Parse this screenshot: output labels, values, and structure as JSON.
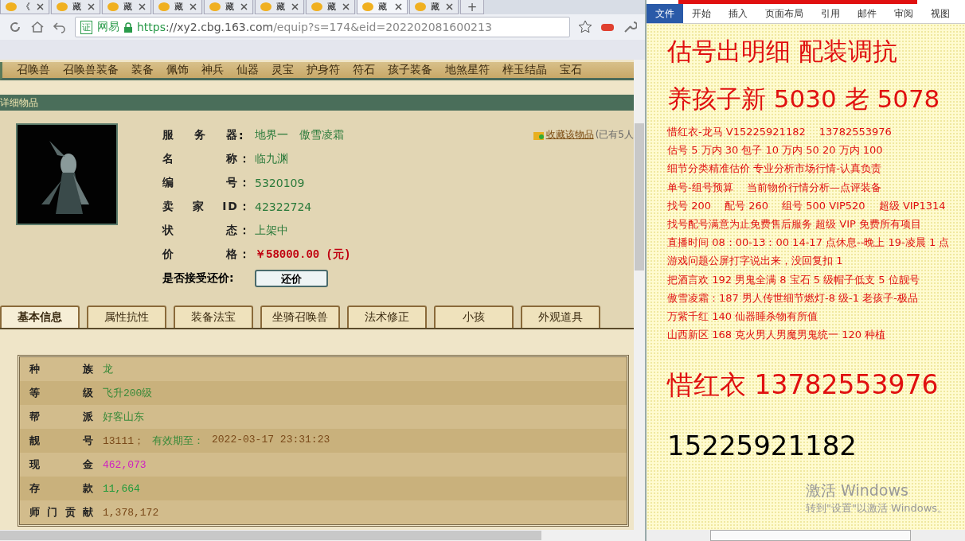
{
  "browser": {
    "tabs": [
      {
        "label": "《",
        "selected": false
      },
      {
        "label": "藏",
        "selected": false
      },
      {
        "label": "藏",
        "selected": false
      },
      {
        "label": "藏",
        "selected": false
      },
      {
        "label": "藏",
        "selected": false
      },
      {
        "label": "藏",
        "selected": false
      },
      {
        "label": "藏",
        "selected": false
      },
      {
        "label": "藏",
        "selected": true
      },
      {
        "label": "藏",
        "selected": false
      }
    ],
    "new_tab": "+",
    "address": {
      "badge": "证",
      "site": "网易",
      "scheme": "https",
      "host": "://xy2.cbg.163.com",
      "path": "/equip?s=174&eid=202202081600213"
    }
  },
  "page": {
    "nav": [
      "召唤兽",
      "召唤兽装备",
      "装备",
      "佩饰",
      "神兵",
      "仙器",
      "灵宝",
      "护身符",
      "符石",
      "孩子装备",
      "地煞星符",
      "梓玉结晶",
      "宝石"
    ],
    "section_title": "详细物品",
    "details": [
      {
        "label": "服务器",
        "colon": ":",
        "value": "地界一　傲雪凌霜",
        "kind": "text"
      },
      {
        "label": "名称",
        "colon": "：",
        "value": "临九渊",
        "kind": "text"
      },
      {
        "label": "编号",
        "colon": "：",
        "value": "5320109",
        "kind": "text"
      },
      {
        "label": "卖家ID",
        "colon": "：",
        "value": "42322724",
        "kind": "text"
      },
      {
        "label": "状态",
        "colon": "：",
        "value": "上架中",
        "kind": "text"
      },
      {
        "label": "价格",
        "colon": "：",
        "value": "￥58000.00 (元)",
        "kind": "price"
      }
    ],
    "bargain": {
      "label": "是否接受还价:",
      "button": "还价"
    },
    "favorite": {
      "link": "收藏该物品",
      "note": "(已有5人"
    },
    "tabs": [
      {
        "label": "基本信息",
        "selected": true
      },
      {
        "label": "属性抗性",
        "selected": false
      },
      {
        "label": "装备法宝",
        "selected": false
      },
      {
        "label": "坐骑召唤兽",
        "selected": false
      },
      {
        "label": "法术修正",
        "selected": false
      },
      {
        "label": "小孩",
        "selected": false
      },
      {
        "label": "外观道具",
        "selected": false
      }
    ],
    "info_rows": [
      {
        "label": "种族",
        "segments": [
          {
            "text": "龙",
            "color": "#3a8a3a"
          }
        ]
      },
      {
        "label": "等级",
        "segments": [
          {
            "text": "飞升200级",
            "color": "#3a8a3a"
          }
        ]
      },
      {
        "label": "帮派",
        "segments": [
          {
            "text": "好客山东",
            "color": "#3a8a3a"
          }
        ]
      },
      {
        "label": "靓号",
        "segments": [
          {
            "text": "13111；",
            "color": "#7a4a1a"
          },
          {
            "text": "有效期至：",
            "color": "#3a8a3a"
          },
          {
            "text": "2022-03-17 23:31:23",
            "color": "#7a4a1a"
          }
        ]
      },
      {
        "label": "现金",
        "segments": [
          {
            "text": "462,073",
            "color": "#d020c0"
          }
        ]
      },
      {
        "label": "存款",
        "segments": [
          {
            "text": "11,664",
            "color": "#1f9a3a"
          }
        ]
      },
      {
        "label": "师门贡献",
        "segments": [
          {
            "text": "1,378,172",
            "color": "#7a4a1a"
          }
        ]
      }
    ]
  },
  "word": {
    "tabs": [
      {
        "label": "文件",
        "selected": true
      },
      {
        "label": "开始",
        "selected": false
      },
      {
        "label": "插入",
        "selected": false
      },
      {
        "label": "页面布局",
        "selected": false
      },
      {
        "label": "引用",
        "selected": false
      },
      {
        "label": "邮件",
        "selected": false
      },
      {
        "label": "审阅",
        "selected": false
      },
      {
        "label": "视图",
        "selected": false
      }
    ],
    "lines": [
      {
        "text": "估号出明细  配装调抗",
        "kind": "heading"
      },
      {
        "text": "养孩子新 5030 老 5078",
        "kind": "heading"
      },
      {
        "text": "惜红衣-龙马 V15225921182　 13782553976",
        "kind": "body"
      },
      {
        "text": "估号 5 万内 30 包子  10 万内 50  20 万内 100",
        "kind": "body"
      },
      {
        "text": "细节分类精准估价  专业分析市场行情-认真负责",
        "kind": "body"
      },
      {
        "text": "单号-组号预算　 当前物价行情分析—点评装备",
        "kind": "body"
      },
      {
        "text": "找号 200　 配号 260　 组号 500  VIP520　 超级 VIP1314",
        "kind": "body"
      },
      {
        "text": "找号配号满意为止免费售后服务  超级 VIP 免费所有项目",
        "kind": "body"
      },
      {
        "text": "直播时间 08：00-13：00  14-17 点休息--晚上 19-凌晨 1 点",
        "kind": "body"
      },
      {
        "text": "游戏问题公屏打字说出来，没回复扣 1",
        "kind": "body"
      },
      {
        "text": "把酒言欢 192 男鬼全满 8 宝石 5 级帽子低支 5 位靓号",
        "kind": "body"
      },
      {
        "text": "傲雪凌霜：187 男人传世细节燃灯-8 级-1 老孩子-极品",
        "kind": "body"
      },
      {
        "text": "万紫千红 140 仙器睡杀物有所值",
        "kind": "body"
      },
      {
        "text": "山西新区 168 克火男人男魔男鬼统一 120 种植",
        "kind": "body"
      },
      {
        "text": "惜红衣 13782553976",
        "kind": "big"
      },
      {
        "text": "15225921182",
        "kind": "black"
      }
    ],
    "activation": [
      "激活 Windows",
      "转到\"设置\"以激活 Windows。"
    ]
  }
}
